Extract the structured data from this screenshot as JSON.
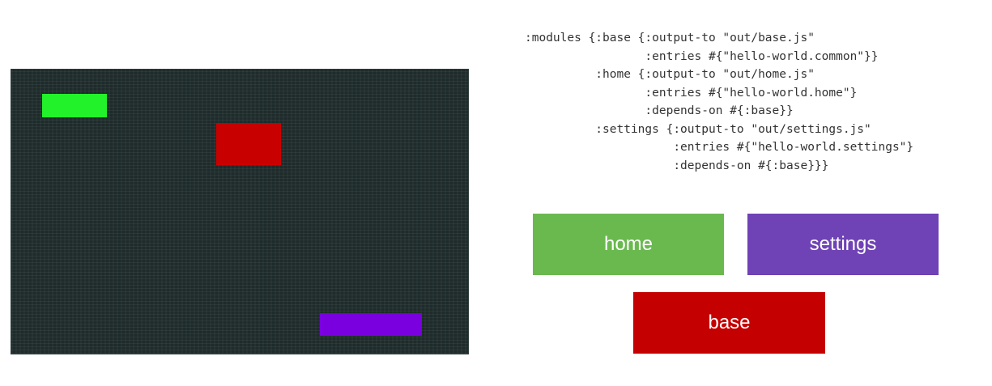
{
  "colors": {
    "screen_bg": "#1f2b2b",
    "green": "#22f22a",
    "red": "#c80000",
    "purple": "#7a00e0",
    "home": "#6ab94f",
    "settings": "#6f42b5",
    "base": "#c50000"
  },
  "code_lines": [
    ":modules {:base {:output-to \"out/base.js\"",
    "                 :entries #{\"hello-world.common\"}}",
    "          :home {:output-to \"out/home.js\"",
    "                 :entries #{\"hello-world.home\"}",
    "                 :depends-on #{:base}}",
    "          :settings {:output-to \"out/settings.js\"",
    "                     :entries #{\"hello-world.settings\"}",
    "                     :depends-on #{:base}}}"
  ],
  "modules": {
    "home": "home",
    "settings": "settings",
    "base": "base"
  }
}
